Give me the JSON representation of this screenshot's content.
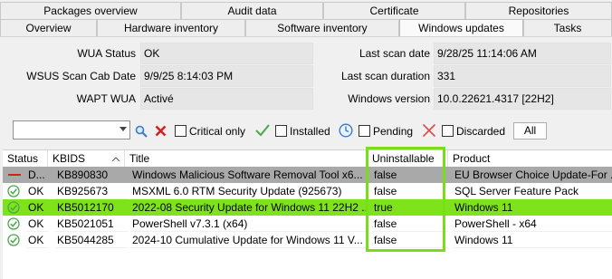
{
  "tabs_row1": [
    {
      "label": "Packages overview"
    },
    {
      "label": "Audit data"
    },
    {
      "label": "Certificate"
    },
    {
      "label": "Repositories"
    }
  ],
  "tabs_row2": [
    {
      "label": "Overview"
    },
    {
      "label": "Hardware inventory"
    },
    {
      "label": "Software inventory"
    },
    {
      "label": "Windows updates",
      "active": true
    },
    {
      "label": "Tasks"
    }
  ],
  "status": {
    "wua_status_label": "WUA Status",
    "wua_status_value": "OK",
    "wsus_label": "WSUS Scan Cab Date",
    "wsus_value": "9/9/25 8:14:03 PM",
    "wapt_wua_label": "WAPT WUA",
    "wapt_wua_value": "Activé",
    "last_scan_date_label": "Last scan date",
    "last_scan_date_value": "9/28/25 11:14:06 AM",
    "last_scan_duration_label": "Last scan duration",
    "last_scan_duration_value": "331",
    "windows_version_label": "Windows version",
    "windows_version_value": "10.0.22621.4317 [22H2]"
  },
  "filters": {
    "search_value": "",
    "critical_only": "Critical only",
    "installed": "Installed",
    "pending": "Pending",
    "discarded": "Discarded",
    "all_button": "All"
  },
  "grid": {
    "columns": [
      "Status",
      "KBIDS",
      "Title",
      "Uninstallable",
      "Product"
    ],
    "rows": [
      {
        "status": "D...",
        "kbids": "KB890830",
        "title": "Windows Malicious Software Removal Tool x6...",
        "uninstallable": "false",
        "product": "EU Browser Choice Update-For ...",
        "style": "sel",
        "icon": "dash"
      },
      {
        "status": "OK",
        "kbids": "KB925673",
        "title": "MSXML 6.0 RTM Security Update  (925673)",
        "uninstallable": "false",
        "product": "SQL Server Feature Pack",
        "style": "normal",
        "icon": "ok"
      },
      {
        "status": "OK",
        "kbids": "KB5012170",
        "title": "2022-08 Security Update for Windows 11 22H2 ...",
        "uninstallable": "true",
        "product": "Windows 11",
        "style": "hl",
        "icon": "ok"
      },
      {
        "status": "OK",
        "kbids": "KB5021051",
        "title": "PowerShell v7.3.1 (x64)",
        "uninstallable": "false",
        "product": "PowerShell - x64",
        "style": "normal",
        "icon": "ok"
      },
      {
        "status": "OK",
        "kbids": "KB5044285",
        "title": "2024-10 Cumulative Update for Windows 11 V...",
        "uninstallable": "false",
        "product": "Windows 11",
        "style": "normal",
        "icon": "ok"
      }
    ]
  },
  "colors": {
    "highlight": "#7fe31c",
    "selected": "#a9a9a9",
    "ok_icon": "#4aa84a",
    "discard_icon": "#d32020"
  }
}
